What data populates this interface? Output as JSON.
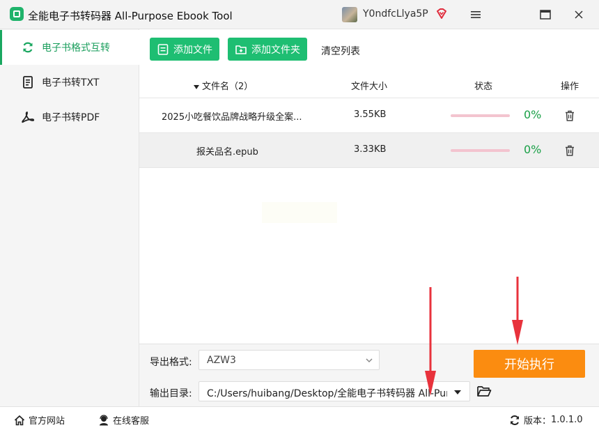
{
  "window": {
    "title": "全能电子书转码器 All-Purpose Ebook Tool",
    "user_name": "Y0ndfcLlya5P",
    "controls": [
      "menu-icon",
      "maximize-icon",
      "close-icon"
    ]
  },
  "sidebar": {
    "items": [
      {
        "label": "电子书格式互转",
        "icon": "refresh-icon",
        "active": true
      },
      {
        "label": "电子书转TXT",
        "icon": "txt-document-icon",
        "active": false
      },
      {
        "label": "电子书转PDF",
        "icon": "pdf-icon",
        "active": false
      }
    ]
  },
  "toolbar": {
    "add_file_label": "添加文件",
    "add_folder_label": "添加文件夹",
    "clear_list_label": "清空列表"
  },
  "table": {
    "headers": {
      "filename": "文件名（2）",
      "size": "文件大小",
      "status": "状态",
      "action": "操作"
    },
    "rows": [
      {
        "name": "2025小吃餐饮品牌战略升级全案...",
        "size": "3.55KB",
        "progress_percent": 0,
        "status_text": "0%"
      },
      {
        "name": "报关品名.epub",
        "size": "3.33KB",
        "progress_percent": 0,
        "status_text": "0%"
      }
    ]
  },
  "config": {
    "format_label": "导出格式:",
    "format_value": "AZW3",
    "output_label": "输出目录:",
    "output_value": "C:/Users/huibang/Desktop/全能电子书转码器 All-Purpose Ebook Tool",
    "start_label": "开始执行"
  },
  "footer": {
    "website_label": "官方网站",
    "support_label": "在线客服",
    "version_label": "版本：",
    "version_value": "1.0.1.0"
  },
  "colors": {
    "accent_green": "#1ebe72",
    "progress_track": "#f3c4cf",
    "status_green": "#1aa047",
    "start_orange": "#fb8c10",
    "annotation_red": "#e8323c"
  }
}
